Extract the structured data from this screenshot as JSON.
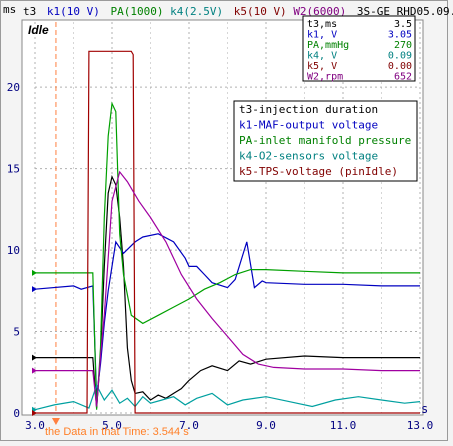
{
  "header": {
    "prefix": "t3",
    "channels": [
      {
        "label": "k1(10 V)",
        "color": "#0000c0"
      },
      {
        "label": "PA(1000)",
        "color": "#008000"
      },
      {
        "label": "k4(2.5V)",
        "color": "#008080"
      },
      {
        "label": "k5(10 V)",
        "color": "#800000"
      },
      {
        "label": "W2(6000)",
        "color": "#800080"
      }
    ],
    "engine": "3S-GE",
    "file": "RHD05.09."
  },
  "axis_unit_y": "ms",
  "axis_unit_x": "s",
  "mode_label": "Idle",
  "readout": {
    "rows": [
      {
        "label": "t3,ms",
        "value": "3.5",
        "color": "#000000"
      },
      {
        "label": "k1, V",
        "value": "3.05",
        "color": "#0000c0"
      },
      {
        "label": "PA,mmHg",
        "value": "270",
        "color": "#008000"
      },
      {
        "label": "k4, V",
        "value": "0.09",
        "color": "#008080"
      },
      {
        "label": "k5, V",
        "value": "0.00",
        "color": "#800000"
      },
      {
        "label": "W2,rpm",
        "value": "652",
        "color": "#800080"
      }
    ]
  },
  "legend": {
    "entries": [
      {
        "text": "t3-injection duration",
        "color": "#000000"
      },
      {
        "text": "k1-MAF-output voltage",
        "color": "#0000c0"
      },
      {
        "text": "PA-inlet manifold pressure",
        "color": "#008000"
      },
      {
        "text": "k4-O2-sensors voltage",
        "color": "#008080"
      },
      {
        "text": "k5-TPS-voltage (pinIdle)",
        "color": "#800000"
      }
    ]
  },
  "status": {
    "text": "the Data in that Time: 3.544 s",
    "color": "#ff7f27"
  },
  "colors": {
    "t3": "#000000",
    "k1": "#0000c0",
    "PA": "#00a000",
    "k4": "#00a0a0",
    "k5": "#a00000",
    "W2": "#a000a0",
    "cursor": "#ff8040",
    "grid": "#b0b0b0"
  },
  "chart_data": {
    "type": "line",
    "xlim": [
      3.0,
      13.0
    ],
    "ylim": [
      0,
      24
    ],
    "x_ticks": [
      "3.0",
      "5.0",
      "7.0",
      "9.0",
      "11.0",
      "13.0"
    ],
    "y_ticks": [
      "0",
      "5",
      "10",
      "15",
      "20"
    ],
    "grid": true,
    "cursor_x": 3.544,
    "series": [
      {
        "name": "t3",
        "key": "t3",
        "points": [
          [
            3.0,
            3.4
          ],
          [
            4.5,
            3.4
          ],
          [
            4.6,
            0.3
          ],
          [
            4.7,
            3.5
          ],
          [
            4.8,
            9.0
          ],
          [
            4.9,
            13.5
          ],
          [
            5.0,
            14.5
          ],
          [
            5.1,
            14.0
          ],
          [
            5.2,
            12.0
          ],
          [
            5.3,
            9.0
          ],
          [
            5.4,
            4.0
          ],
          [
            5.5,
            2.0
          ],
          [
            5.6,
            1.2
          ],
          [
            5.8,
            1.3
          ],
          [
            6.0,
            0.8
          ],
          [
            6.2,
            1.1
          ],
          [
            6.4,
            0.9
          ],
          [
            6.6,
            1.2
          ],
          [
            6.8,
            1.5
          ],
          [
            7.0,
            2.0
          ],
          [
            7.3,
            2.6
          ],
          [
            7.6,
            2.9
          ],
          [
            8.0,
            2.6
          ],
          [
            8.3,
            3.2
          ],
          [
            8.6,
            3.0
          ],
          [
            9.0,
            3.3
          ],
          [
            10.0,
            3.5
          ],
          [
            11.0,
            3.4
          ],
          [
            12.0,
            3.4
          ],
          [
            13.0,
            3.4
          ]
        ]
      },
      {
        "name": "k1",
        "key": "k1",
        "points": [
          [
            3.0,
            7.6
          ],
          [
            4.0,
            7.8
          ],
          [
            4.2,
            7.6
          ],
          [
            4.5,
            7.8
          ],
          [
            4.6,
            1.0
          ],
          [
            4.7,
            3.0
          ],
          [
            4.8,
            5.5
          ],
          [
            4.9,
            7.5
          ],
          [
            5.0,
            9.0
          ],
          [
            5.1,
            10.5
          ],
          [
            5.3,
            9.8
          ],
          [
            5.6,
            10.5
          ],
          [
            5.8,
            10.8
          ],
          [
            6.2,
            11.0
          ],
          [
            6.6,
            10.5
          ],
          [
            6.9,
            9.5
          ],
          [
            7.0,
            9.0
          ],
          [
            7.2,
            9.0
          ],
          [
            7.4,
            8.5
          ],
          [
            7.6,
            8.0
          ],
          [
            8.0,
            7.7
          ],
          [
            8.2,
            8.2
          ],
          [
            8.5,
            10.5
          ],
          [
            8.7,
            7.7
          ],
          [
            8.9,
            8.1
          ],
          [
            9.0,
            8.0
          ],
          [
            10.0,
            7.9
          ],
          [
            11.0,
            7.9
          ],
          [
            12.0,
            7.8
          ],
          [
            13.0,
            7.8
          ]
        ]
      },
      {
        "name": "PA",
        "key": "PA",
        "points": [
          [
            3.0,
            8.6
          ],
          [
            4.0,
            8.6
          ],
          [
            4.5,
            8.6
          ],
          [
            4.6,
            0.2
          ],
          [
            4.7,
            4.0
          ],
          [
            4.8,
            12.0
          ],
          [
            4.9,
            17.0
          ],
          [
            5.0,
            19.0
          ],
          [
            5.1,
            18.5
          ],
          [
            5.2,
            11.0
          ],
          [
            5.3,
            8.5
          ],
          [
            5.5,
            6.0
          ],
          [
            5.8,
            5.5
          ],
          [
            6.2,
            6.0
          ],
          [
            6.6,
            6.5
          ],
          [
            7.0,
            7.0
          ],
          [
            7.4,
            7.6
          ],
          [
            7.8,
            8.0
          ],
          [
            8.2,
            8.5
          ],
          [
            8.6,
            8.8
          ],
          [
            9.0,
            8.8
          ],
          [
            10.0,
            8.7
          ],
          [
            11.0,
            8.6
          ],
          [
            12.0,
            8.6
          ],
          [
            13.0,
            8.6
          ]
        ]
      },
      {
        "name": "k4",
        "key": "k4",
        "points": [
          [
            3.0,
            0.2
          ],
          [
            3.5,
            0.5
          ],
          [
            4.0,
            0.7
          ],
          [
            4.4,
            0.3
          ],
          [
            4.6,
            1.7
          ],
          [
            4.8,
            0.8
          ],
          [
            5.0,
            1.4
          ],
          [
            5.2,
            0.6
          ],
          [
            5.4,
            0.9
          ],
          [
            5.6,
            0.4
          ],
          [
            5.8,
            1.0
          ],
          [
            6.0,
            0.6
          ],
          [
            6.3,
            0.8
          ],
          [
            6.6,
            1.0
          ],
          [
            6.9,
            0.5
          ],
          [
            7.2,
            0.9
          ],
          [
            7.6,
            1.2
          ],
          [
            8.0,
            0.5
          ],
          [
            8.4,
            0.8
          ],
          [
            9.0,
            1.0
          ],
          [
            9.6,
            0.7
          ],
          [
            10.2,
            0.4
          ],
          [
            10.8,
            0.8
          ],
          [
            11.4,
            1.0
          ],
          [
            12.0,
            0.8
          ],
          [
            12.6,
            0.6
          ],
          [
            13.0,
            0.7
          ]
        ]
      },
      {
        "name": "k5",
        "key": "k5",
        "points": [
          [
            3.0,
            0.0
          ],
          [
            4.35,
            0.0
          ],
          [
            4.4,
            22.2
          ],
          [
            4.5,
            22.2
          ],
          [
            5.5,
            22.2
          ],
          [
            5.55,
            22.0
          ],
          [
            5.6,
            0.0
          ],
          [
            7.0,
            0.0
          ],
          [
            9.0,
            0.0
          ],
          [
            11.0,
            0.0
          ],
          [
            13.0,
            0.0
          ]
        ]
      },
      {
        "name": "W2",
        "key": "W2",
        "points": [
          [
            3.0,
            2.6
          ],
          [
            4.5,
            2.6
          ],
          [
            4.6,
            0.4
          ],
          [
            4.7,
            3.5
          ],
          [
            4.8,
            6.0
          ],
          [
            4.9,
            9.5
          ],
          [
            5.0,
            13.0
          ],
          [
            5.2,
            14.8
          ],
          [
            5.4,
            14.2
          ],
          [
            5.7,
            13.0
          ],
          [
            6.0,
            12.0
          ],
          [
            6.4,
            10.5
          ],
          [
            6.8,
            8.5
          ],
          [
            7.2,
            7.0
          ],
          [
            7.6,
            5.8
          ],
          [
            8.0,
            4.7
          ],
          [
            8.4,
            3.6
          ],
          [
            8.8,
            3.0
          ],
          [
            9.2,
            2.8
          ],
          [
            10.0,
            2.7
          ],
          [
            11.0,
            2.7
          ],
          [
            12.0,
            2.6
          ],
          [
            13.0,
            2.6
          ]
        ]
      }
    ]
  }
}
